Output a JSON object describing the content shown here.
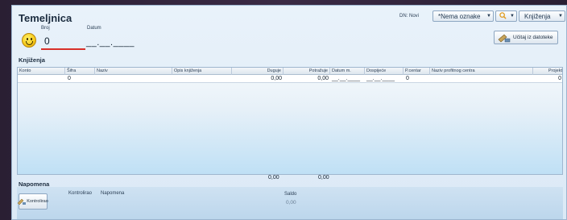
{
  "header": {
    "title": "Temeljnica",
    "broj_label": "Broj",
    "broj_value": "0",
    "datum_label": "Datum",
    "datum_value": "__.__.____",
    "dn_label": "DN: Novi",
    "oznake_combo": "*Nema oznake",
    "knjizenja_combo": "Knjiženja",
    "ucitaj_button": "Učitaj iz datoteke"
  },
  "grid": {
    "section_label": "Knjiženja",
    "columns": [
      "Konto",
      "Šifra",
      "Naziv",
      "Opis knjiženja",
      "Duguje",
      "Potražuje",
      "Datum m.",
      "Dospijeće",
      "P.centar",
      "Naziv profitnog centra",
      "Projekt"
    ],
    "row": {
      "sifra": "0",
      "duguje": "0,00",
      "potrazuje": "0,00",
      "datum_m": "__.__.____",
      "dospijece": "__.__.____",
      "pcentar": "0",
      "projekt": "0"
    },
    "totals": {
      "duguje": "0,00",
      "potrazuje": "0,00"
    }
  },
  "napomena": {
    "section_label": "Napomena",
    "kontrolirao_button": "Kontrolirao",
    "kontrolirao_label": "Kontrolirao",
    "napomena_label": "Napomena",
    "saldo_label": "Saldo",
    "saldo_value": "0,00"
  },
  "colors": {
    "accent_underline": "#d8302a",
    "grid_bottom": "#bfe0f5"
  },
  "icons": [
    "smiley-icon",
    "search-icon",
    "import-icon",
    "stamp-icon"
  ]
}
